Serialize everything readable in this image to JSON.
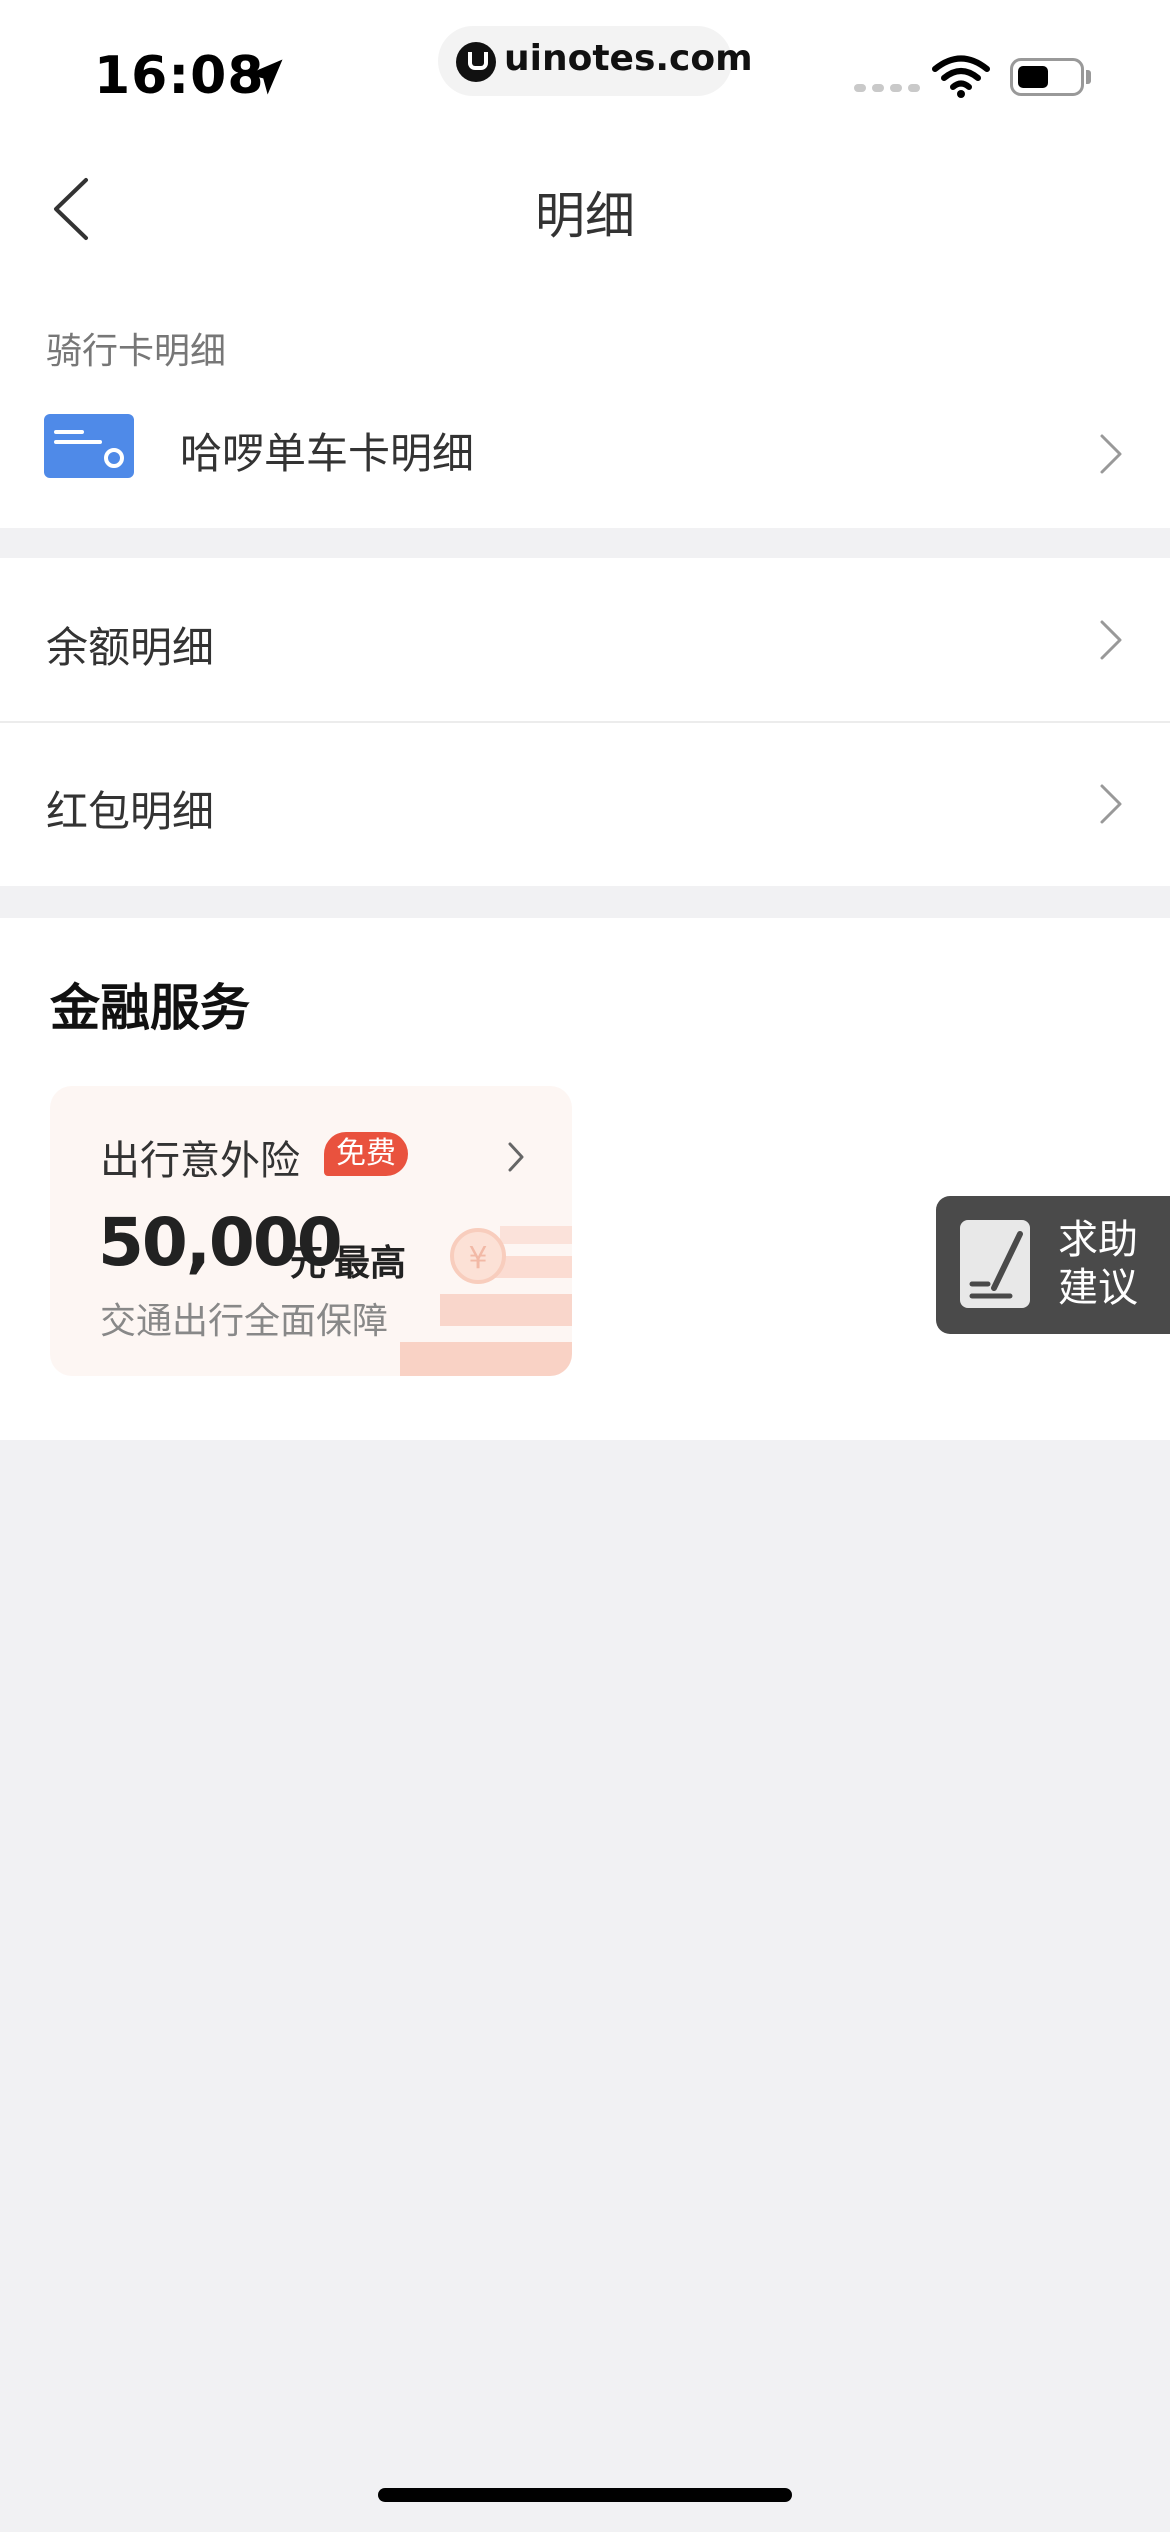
{
  "status_bar": {
    "time": "16:08",
    "url": "uinotes.com",
    "icons": [
      "location-arrow-icon",
      "wifi-icon",
      "battery-icon"
    ]
  },
  "nav": {
    "title": "明细",
    "back_icon": "chevron-left-icon"
  },
  "riding_card": {
    "section_label": "骑行卡明细",
    "item_label": "哈啰单车卡明细",
    "icon": "card-icon",
    "icon_color": "#4f8ae8"
  },
  "details": {
    "items": [
      {
        "label": "余额明细"
      },
      {
        "label": "红包明细"
      }
    ]
  },
  "finance": {
    "title": "金融服务",
    "insurance": {
      "title": "出行意外险",
      "badge": "免费",
      "amount": "50,000",
      "unit": "元",
      "suffix": "最高",
      "subtitle": "交通出行全面保障",
      "badge_color": "#e9523e"
    }
  },
  "help": {
    "line1": "求助",
    "line2": "建议"
  }
}
